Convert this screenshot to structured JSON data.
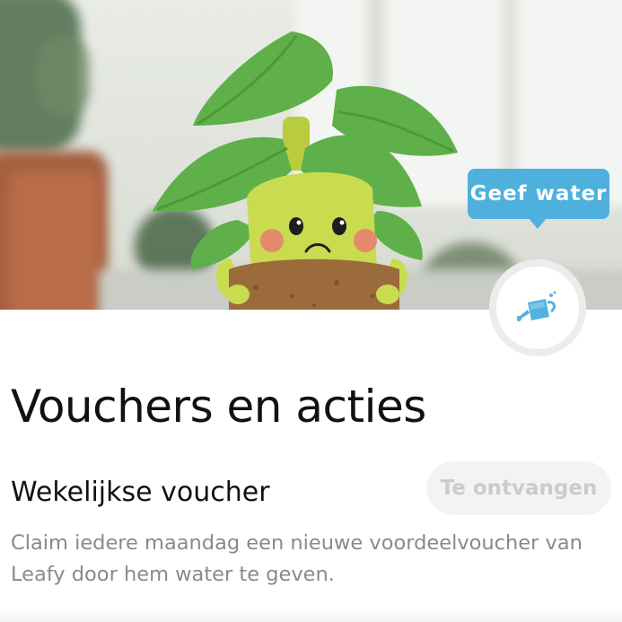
{
  "hero": {
    "tooltip_label": "Geef water",
    "water_button_icon": "watering-can-icon",
    "mascot_icon": "leafy-plant-mascot-icon"
  },
  "section": {
    "title": "Vouchers en acties"
  },
  "voucher": {
    "title": "Wekelijkse voucher",
    "status_label": "Te ontvangen",
    "description": "Claim iedere maandag een nieuwe voordeelvoucher van Leafy door hem water te geven."
  },
  "colors": {
    "accent_blue": "#4eb0dd",
    "leaf_green": "#5fb04a",
    "title_text": "#111111",
    "muted_text": "#8a8a8a",
    "disabled_text": "#cbcbcb"
  }
}
